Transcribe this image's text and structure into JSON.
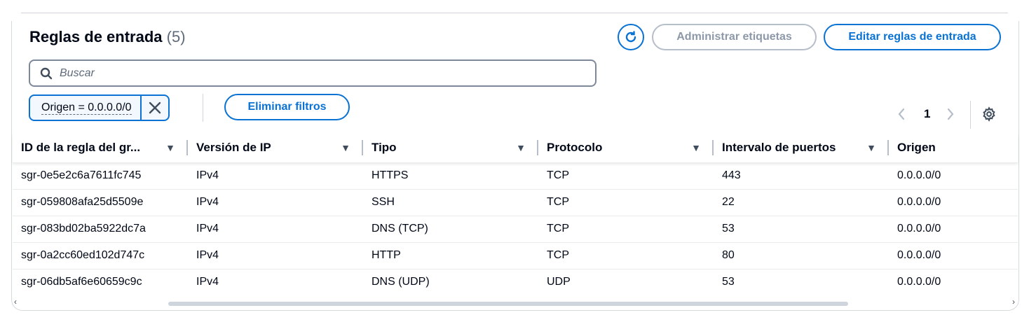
{
  "header": {
    "title": "Reglas de entrada",
    "count": "(5)",
    "manage_tags_label": "Administrar etiquetas",
    "edit_rules_label": "Editar reglas de entrada"
  },
  "search": {
    "placeholder": "Buscar",
    "value": ""
  },
  "filter_token": {
    "label": "Origen = 0.0.0.0/0"
  },
  "clear_filters_label": "Eliminar filtros",
  "pagination": {
    "current_page": "1",
    "prev": "‹",
    "next": "›"
  },
  "table": {
    "columns": [
      "ID de la regla del gr...",
      "Versión de IP",
      "Tipo",
      "Protocolo",
      "Intervalo de puertos",
      "Origen"
    ],
    "rows": [
      [
        "sgr-0e5e2c6a7611fc745",
        "IPv4",
        "HTTPS",
        "TCP",
        "443",
        "0.0.0.0/0"
      ],
      [
        "sgr-059808afa25d5509e",
        "IPv4",
        "SSH",
        "TCP",
        "22",
        "0.0.0.0/0"
      ],
      [
        "sgr-083bd02ba5922dc7a",
        "IPv4",
        "DNS (TCP)",
        "TCP",
        "53",
        "0.0.0.0/0"
      ],
      [
        "sgr-0a2cc60ed102d747c",
        "IPv4",
        "HTTP",
        "TCP",
        "80",
        "0.0.0.0/0"
      ],
      [
        "sgr-06db5af6e60659c9c",
        "IPv4",
        "DNS (UDP)",
        "UDP",
        "53",
        "0.0.0.0/0"
      ]
    ]
  },
  "icons": {
    "refresh": "refresh-icon",
    "search": "search-icon",
    "dismiss": "close-icon",
    "sort": "caret-down-icon",
    "settings": "gear-icon"
  },
  "colors": {
    "accent": "#0972d3",
    "disabled": "#8d99a8",
    "text": "#000716"
  }
}
